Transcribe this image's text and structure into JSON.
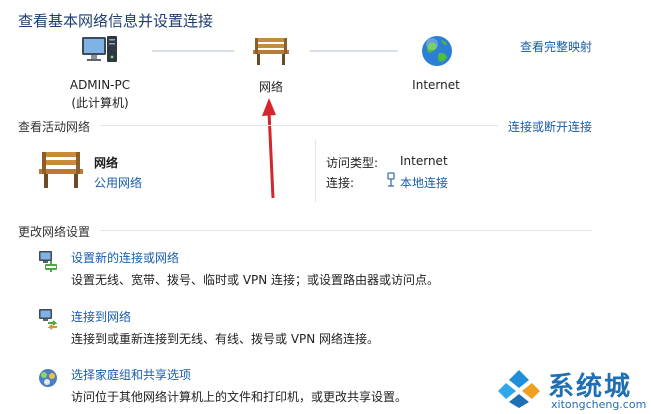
{
  "header": {
    "title": "查看基本网络信息并设置连接",
    "full_map_link": "查看完整映射"
  },
  "network_map": {
    "nodes": [
      {
        "label": "ADMIN-PC",
        "sublabel": "(此计算机)",
        "icon": "computer-icon"
      },
      {
        "label": "网络",
        "icon": "bench-network-icon"
      },
      {
        "label": "Internet",
        "icon": "globe-icon"
      }
    ]
  },
  "active_networks": {
    "heading": "查看活动网络",
    "connect_link": "连接或断开连接",
    "network_name": "网络",
    "network_type": "公用网络",
    "access_type_label": "访问类型:",
    "access_type_value": "Internet",
    "connections_label": "连接:",
    "connections_value": "本地连接"
  },
  "change_settings": {
    "heading": "更改网络设置",
    "tasks": [
      {
        "title": "设置新的连接或网络",
        "desc": "设置无线、宽带、拨号、临时或 VPN 连接；或设置路由器或访问点。",
        "icon": "new-connection-icon"
      },
      {
        "title": "连接到网络",
        "desc": "连接到或重新连接到无线、有线、拨号或 VPN 网络连接。",
        "icon": "connect-network-icon"
      },
      {
        "title": "选择家庭组和共享选项",
        "desc": "访问位于其他网络计算机上的文件和打印机，或更改共享设置。",
        "icon": "homegroup-icon"
      }
    ]
  },
  "watermark": {
    "text": "系统城",
    "url": "xitongcheng.com"
  },
  "colors": {
    "title": "#1e3d73",
    "link": "#1a5dab",
    "annotation_arrow": "#d3272d"
  }
}
